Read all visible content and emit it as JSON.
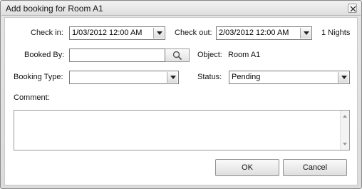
{
  "window": {
    "title": "Add booking for Room A1"
  },
  "form": {
    "check_in_label": "Check in:",
    "check_in_value": "1/03/2012 12:00 AM",
    "check_out_label": "Check out:",
    "check_out_value": "2/03/2012 12:00 AM",
    "nights": "1 Nights",
    "booked_by_label": "Booked By:",
    "booked_by_value": "",
    "object_label": "Object:",
    "object_value": "Room A1",
    "booking_type_label": "Booking Type:",
    "booking_type_value": "",
    "status_label": "Status:",
    "status_value": "Pending",
    "comment_label": "Comment:",
    "comment_value": ""
  },
  "buttons": {
    "ok": "OK",
    "cancel": "Cancel"
  },
  "icons": {
    "close": "close-icon",
    "search": "search-icon"
  }
}
